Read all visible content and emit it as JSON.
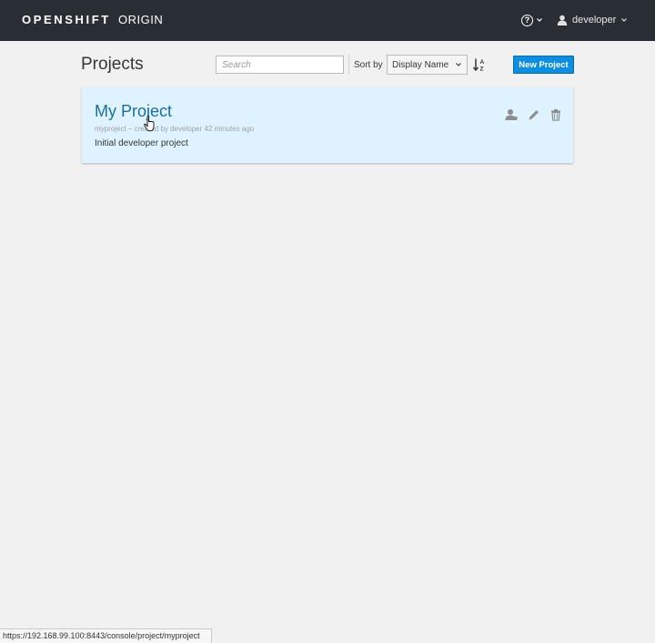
{
  "brand": {
    "bold": "OPENSHIFT",
    "light": "ORIGIN"
  },
  "topbar": {
    "help_icon": "question-circle-icon",
    "user": {
      "name": "developer",
      "icon": "user-icon"
    }
  },
  "page": {
    "title": "Projects"
  },
  "toolbar": {
    "search_placeholder": "Search",
    "sort_label": "Sort by",
    "sort_value": "Display Name",
    "sort_direction_icon": "sort-alpha-asc-icon",
    "new_project_label": "New Project"
  },
  "projects": [
    {
      "display_name": "My Project",
      "meta": "myproject – created by developer 42 minutes ago",
      "description": "Initial developer project",
      "actions": [
        "view-membership-icon",
        "edit-icon",
        "delete-icon"
      ]
    }
  ],
  "status_bar": {
    "url": "https://192.168.99.100:8443/console/project/myproject"
  },
  "colors": {
    "topbar": "#292e34",
    "accent": "#0e8ee0",
    "card_bg": "#def3ff",
    "link": "#1b6ea2"
  }
}
